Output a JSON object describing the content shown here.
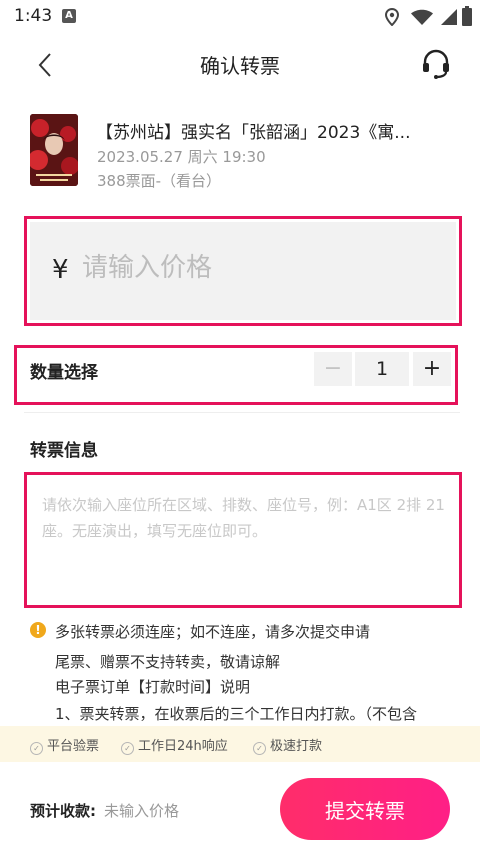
{
  "status_bar": {
    "time": "1:43",
    "notification_letter": "A"
  },
  "header": {
    "title": "确认转票"
  },
  "event": {
    "title": "【苏州站】强实名「张韶涵」2023《寓...",
    "datetime": "2023.05.27 周六 19:30",
    "seat": "388票面-（看台）"
  },
  "price": {
    "currency": "¥",
    "placeholder": "请输入价格",
    "value": ""
  },
  "quantity": {
    "label": "数量选择",
    "minus": "−",
    "value": "1",
    "plus": "+"
  },
  "ticket_info": {
    "label": "转票信息",
    "placeholder": "请依次输入座位所在区域、排数、座位号，例：A1区 2排 21座。无座演出，填写无座位即可。",
    "value": ""
  },
  "notice": {
    "icon": "!",
    "lines": [
      "多张转票必须连座；如不连座，请多次提交申请",
      "尾票、赠票不支持转卖，敬请谅解",
      "电子票订单【打款时间】说明",
      "1、票夹转票，在收票后的三个工作日内打款。（不包含"
    ]
  },
  "features": [
    "平台验票",
    "工作日24h响应",
    "极速打款"
  ],
  "bottom": {
    "estimate_label": "预计收款:",
    "estimate_value": "未输入价格",
    "submit_label": "提交转票"
  },
  "colors": {
    "accent": "#ff2d6a",
    "highlight_border": "#e5125a",
    "notice_icon": "#f0a81c",
    "feature_bar_bg": "#fdf7e3"
  }
}
